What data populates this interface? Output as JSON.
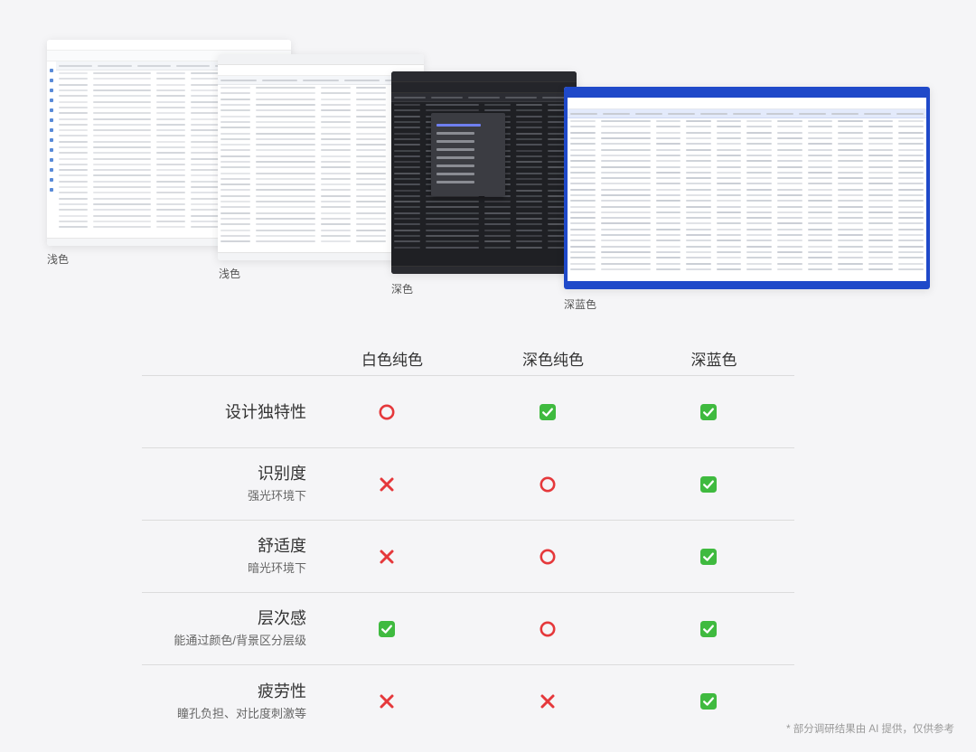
{
  "screenshots": [
    {
      "id": "light1",
      "caption": "浅色"
    },
    {
      "id": "light2",
      "caption": "浅色"
    },
    {
      "id": "dark",
      "caption": "深色"
    },
    {
      "id": "blue",
      "caption": "深蓝色"
    }
  ],
  "table": {
    "columns": [
      "白色纯色",
      "深色纯色",
      "深蓝色"
    ],
    "rows": [
      {
        "label": "设计独特性",
        "sub": "",
        "values": [
          "circle",
          "check",
          "check"
        ]
      },
      {
        "label": "识别度",
        "sub": "强光环境下",
        "values": [
          "cross",
          "circle",
          "check"
        ]
      },
      {
        "label": "舒适度",
        "sub": "暗光环境下",
        "values": [
          "cross",
          "circle",
          "check"
        ]
      },
      {
        "label": "层次感",
        "sub": "能通过颜色/背景区分层级",
        "values": [
          "check",
          "circle",
          "check"
        ]
      },
      {
        "label": "疲劳性",
        "sub": "瞳孔负担、对比度刺激等",
        "values": [
          "cross",
          "cross",
          "check"
        ]
      }
    ]
  },
  "symbols": {
    "circle": {
      "icon": "circle-icon",
      "color": "#e5383b"
    },
    "cross": {
      "icon": "cross-icon",
      "color": "#e5383b"
    },
    "check": {
      "icon": "check-box-icon",
      "color": "#3fba3f"
    }
  },
  "footnote": "* 部分调研结果由 AI 提供，仅供参考"
}
